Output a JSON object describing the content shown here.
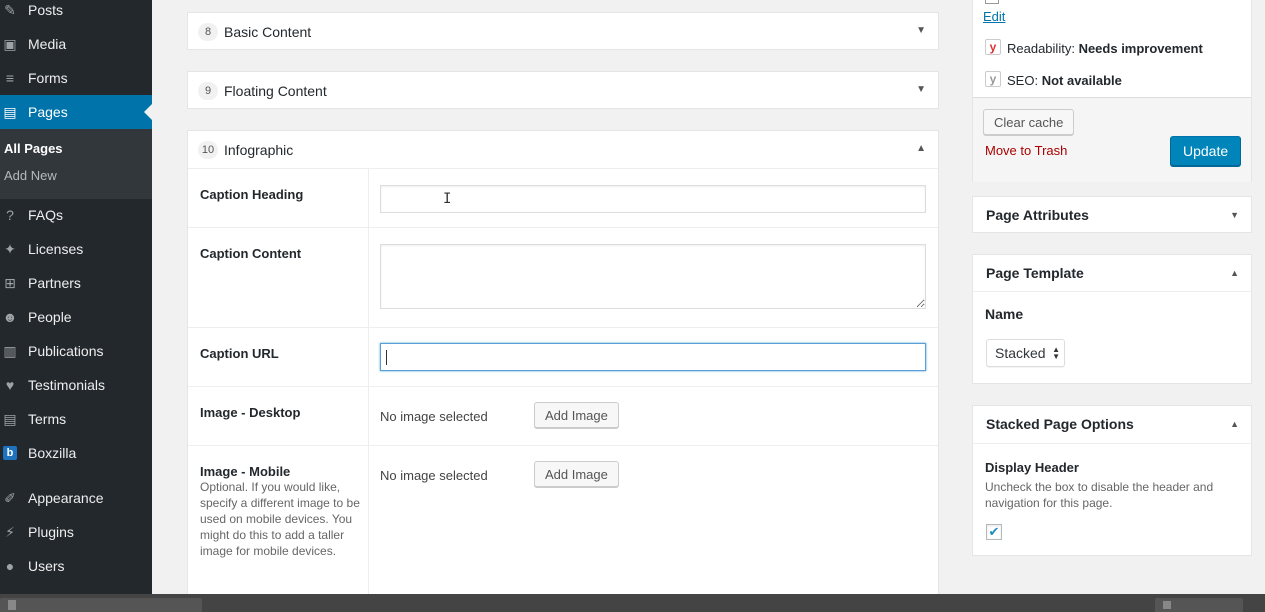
{
  "sidebar": {
    "items": [
      {
        "label": "Posts",
        "icon": "pin-icon",
        "glyph": "✎"
      },
      {
        "label": "Media",
        "icon": "media-icon",
        "glyph": "▣"
      },
      {
        "label": "Forms",
        "icon": "forms-icon",
        "glyph": "≡"
      },
      {
        "label": "Pages",
        "icon": "pages-icon",
        "glyph": "▤"
      },
      {
        "label": "FAQs",
        "icon": "question-icon",
        "glyph": "?"
      },
      {
        "label": "Licenses",
        "icon": "wrench-icon",
        "glyph": "✦"
      },
      {
        "label": "Partners",
        "icon": "network-icon",
        "glyph": "⊞"
      },
      {
        "label": "People",
        "icon": "people-icon",
        "glyph": "☻"
      },
      {
        "label": "Publications",
        "icon": "book-icon",
        "glyph": "▥"
      },
      {
        "label": "Testimonials",
        "icon": "heart-icon",
        "glyph": "♥"
      },
      {
        "label": "Terms",
        "icon": "terms-icon",
        "glyph": "▤"
      },
      {
        "label": "Boxzilla",
        "icon": "boxzilla-icon",
        "glyph": "b"
      },
      {
        "label": "Appearance",
        "icon": "brush-icon",
        "glyph": "✐"
      },
      {
        "label": "Plugins",
        "icon": "plug-icon",
        "glyph": "⚡"
      },
      {
        "label": "Users",
        "icon": "user-icon",
        "glyph": "●"
      }
    ],
    "submenu": {
      "all_pages": "All Pages",
      "add_new": "Add New"
    }
  },
  "main": {
    "sections": [
      {
        "num": "8",
        "title": "Basic Content",
        "toggle": "▼"
      },
      {
        "num": "9",
        "title": "Floating Content",
        "toggle": "▼"
      },
      {
        "num": "10",
        "title": "Infographic",
        "toggle": "▲"
      }
    ],
    "fields": {
      "caption_heading": {
        "label": "Caption Heading",
        "value": ""
      },
      "caption_content": {
        "label": "Caption Content",
        "value": ""
      },
      "caption_url": {
        "label": "Caption URL",
        "value": ""
      },
      "image_desktop": {
        "label": "Image - Desktop",
        "status": "No image selected",
        "button": "Add Image"
      },
      "image_mobile": {
        "label": "Image - Mobile",
        "description": "Optional. If you would like, specify a different image to be used on mobile devices. You might do this to add a taller image for mobile devices.",
        "status": "No image selected",
        "button": "Add Image"
      }
    }
  },
  "publish": {
    "edit_link": "Edit",
    "readability_label": "Readability:",
    "readability_value": "Needs improvement",
    "seo_label": "SEO:",
    "seo_value": "Not available",
    "clear_cache": "Clear cache",
    "move_to_trash": "Move to Trash",
    "update": "Update"
  },
  "page_attributes": {
    "title": "Page Attributes",
    "toggle": "▼"
  },
  "page_template": {
    "title": "Page Template",
    "toggle": "▲",
    "name_label": "Name",
    "selected": "Stacked"
  },
  "stacked_options": {
    "title": "Stacked Page Options",
    "toggle": "▲",
    "display_header": "Display Header",
    "description": "Uncheck the box to disable the header and navigation for this page.",
    "checked": true
  },
  "colors": {
    "sidebar": "#23282d",
    "accent": "#0073aa",
    "trash": "#aa0000",
    "yoast_red": "#dc3232"
  }
}
